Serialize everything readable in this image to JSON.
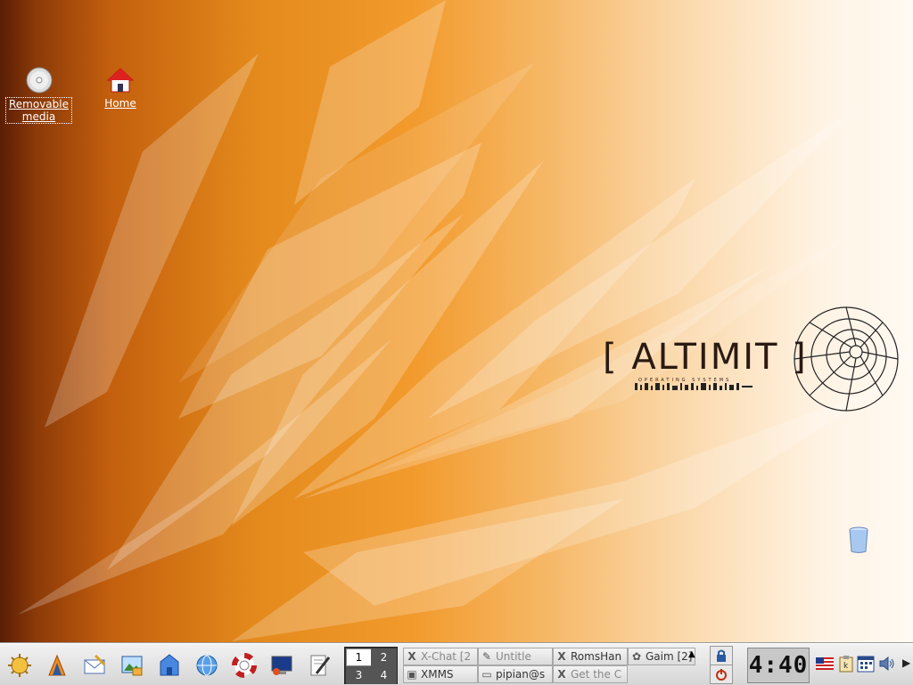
{
  "desktop": {
    "icons": [
      {
        "name": "removable-media",
        "label": "Removable media"
      },
      {
        "name": "home",
        "label": "Home"
      },
      {
        "name": "trash",
        "label": ""
      }
    ],
    "wallpaper_logo": {
      "word": "[ ALTIMIT ]",
      "sub": "OPERATING SYSTEMS"
    }
  },
  "panel": {
    "launchers": [
      "kmenu-icon",
      "konqueror-icon",
      "kmail-icon",
      "kpaint-icon",
      "home-folder-icon",
      "konqueror-globe-icon",
      "help-icon",
      "terminal-icon",
      "kate-icon"
    ],
    "pager": {
      "desktops": [
        "1",
        "2",
        "3",
        "4"
      ],
      "active": "1"
    },
    "tasks": [
      {
        "label": "X-Chat [2",
        "icon": "X"
      },
      {
        "label": "Untitle",
        "icon": "✎"
      },
      {
        "label": "RomsHan",
        "icon": "X"
      },
      {
        "label": "Gaim [2]",
        "icon": "✿"
      },
      {
        "label": "XMMS",
        "icon": "▣"
      },
      {
        "label": "pipian@s",
        "icon": "▭"
      },
      {
        "label": "Get the C",
        "icon": "X"
      }
    ],
    "clock": "4:40",
    "colors": {
      "desktop_accent": "#f29a2c",
      "panel": "#dcdcdc"
    }
  }
}
